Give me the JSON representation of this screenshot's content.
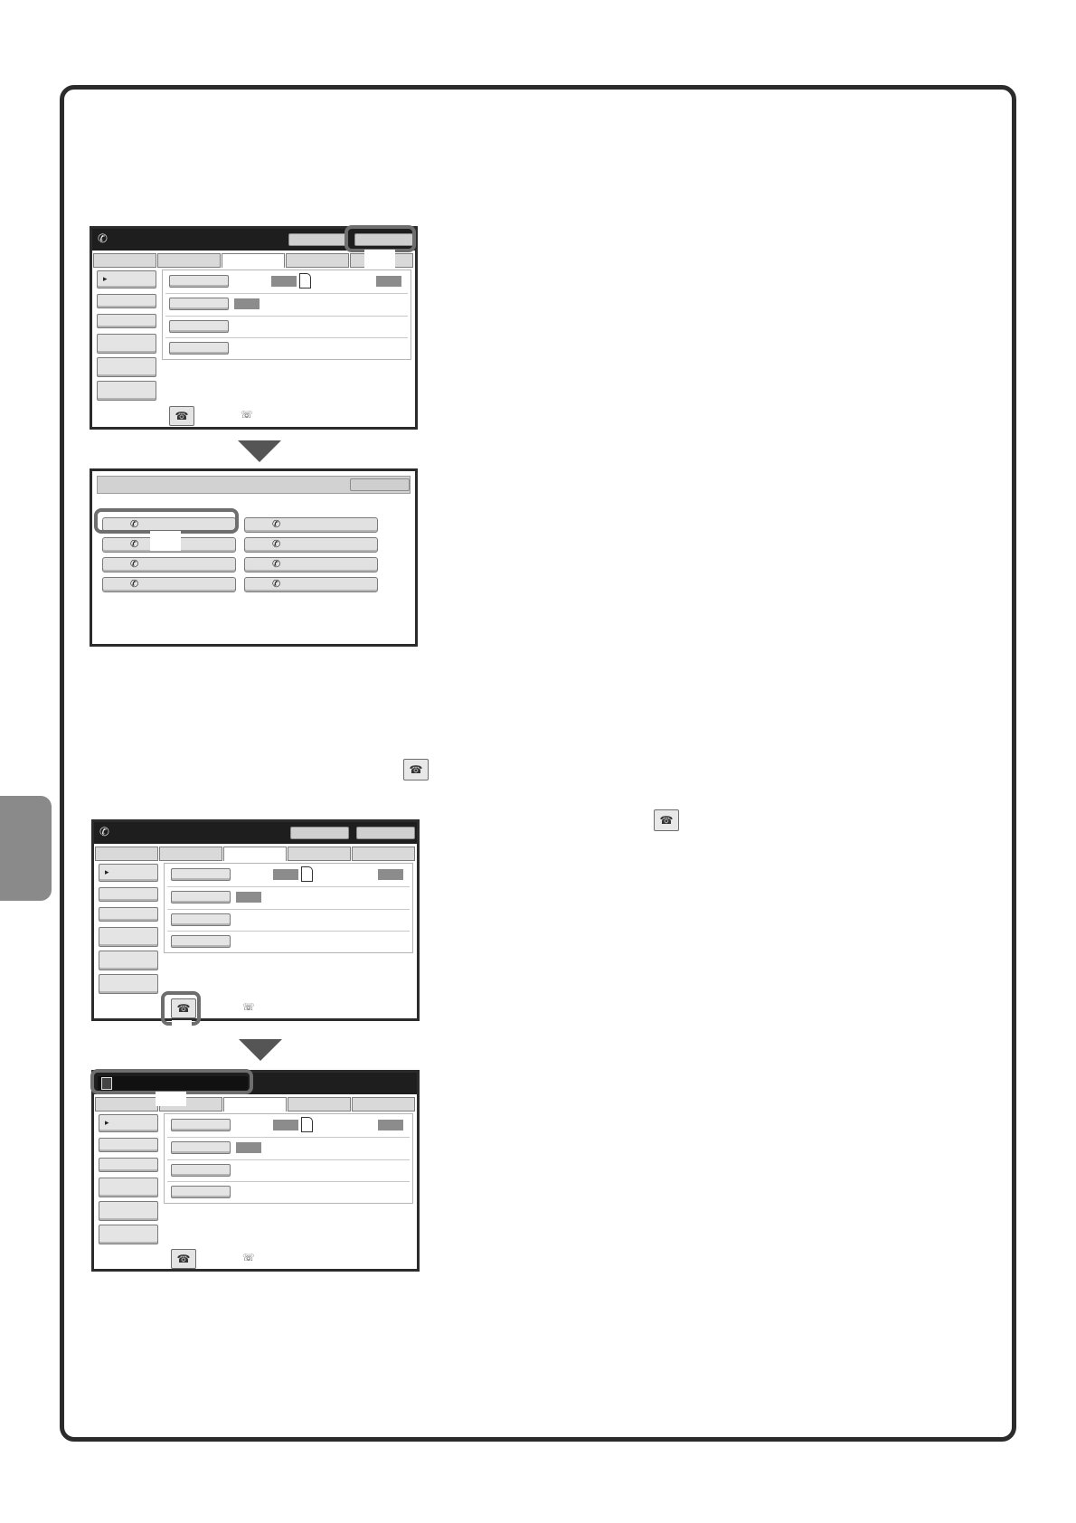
{
  "icons": {
    "phone": "phone-icon",
    "fax_memory": "fax-memory-icon",
    "handset": "handset-icon",
    "job_status": "job-status-icon"
  },
  "glyphs": {
    "phone": "✆",
    "handset": "☏",
    "fax_memory": "☎",
    "caret": "▸"
  },
  "colors": {
    "frame": "#2b2b2b",
    "titlebar": "#1e1e1e",
    "highlight": "#6e6e6e",
    "side_tab": "#8a8a8a"
  }
}
